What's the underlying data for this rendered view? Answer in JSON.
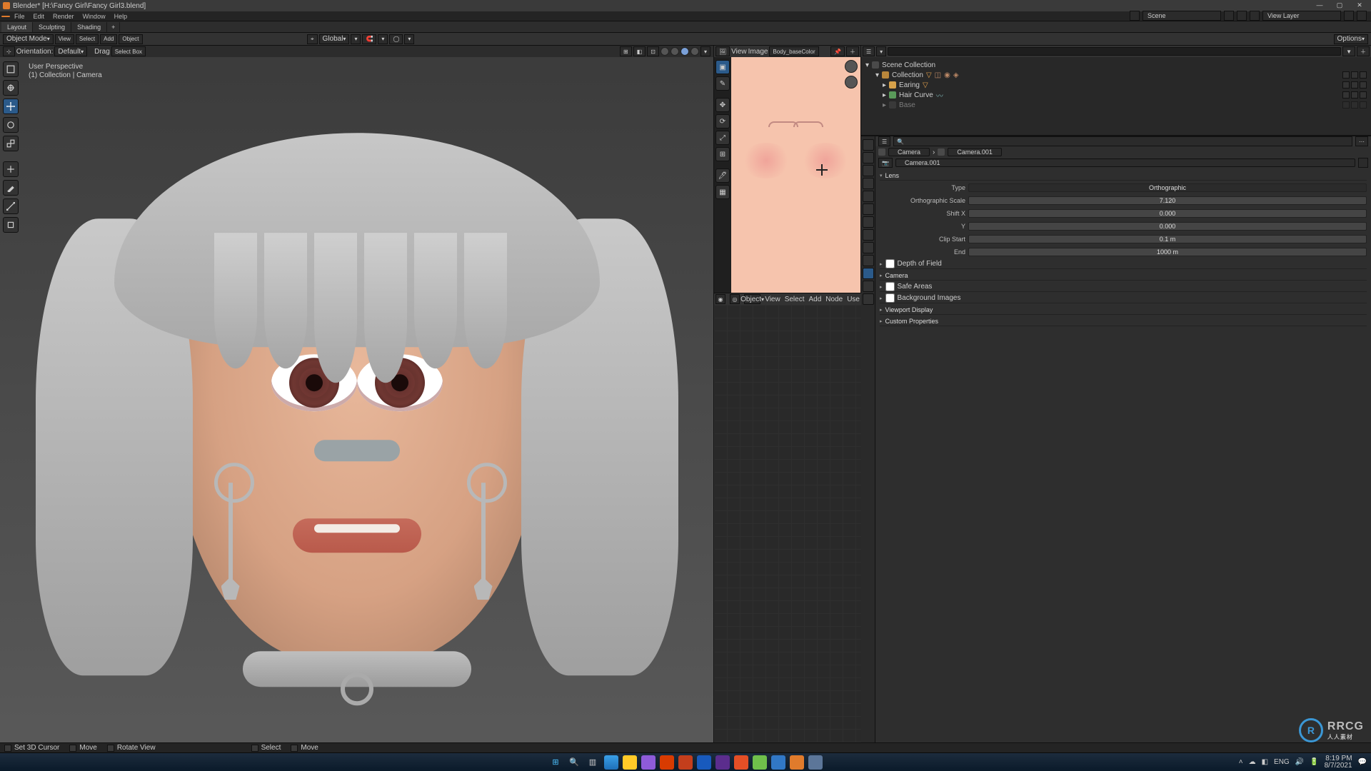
{
  "title": "Blender*  [H:\\Fancy Girl\\Fancy Girl3.blend]",
  "app_menu": [
    "File",
    "Edit",
    "Render",
    "Window",
    "Help"
  ],
  "workspaces": {
    "items": [
      "Layout",
      "Sculpting",
      "Shading"
    ],
    "active": 0,
    "plus": "+"
  },
  "top_scene": {
    "scene_label": "Scene",
    "layer_label": "View Layer"
  },
  "toolbar3d": {
    "mode": "Object Mode",
    "menus": [
      "View",
      "Select",
      "Add",
      "Object"
    ],
    "orientation_label": "Orientation:",
    "global": "Global",
    "drag": "Drag",
    "selectbox": "Select Box",
    "default": "Default",
    "options": "Options"
  },
  "vp_overlay": {
    "line1": "User Perspective",
    "line2": "(1) Collection | Camera"
  },
  "image_panel": {
    "menus": [
      "View",
      "Image"
    ],
    "linked": "Body_baseColor"
  },
  "outliner": {
    "root": "Scene Collection",
    "items": [
      {
        "name": "Collection",
        "depth": 1,
        "icons": 4
      },
      {
        "name": "Earing",
        "depth": 2,
        "icons": 1
      },
      {
        "name": "Hair Curve",
        "depth": 2,
        "icons": 1
      },
      {
        "name": "Base",
        "depth": 2,
        "icons": 0,
        "muted": true
      }
    ]
  },
  "props": {
    "search_placeholder": "",
    "breadcrumb": [
      "Camera",
      "Camera.001"
    ],
    "datablock": "Camera.001",
    "lens_header": "Lens",
    "type_label": "Type",
    "type_value": "Orthographic",
    "ortho_label": "Orthographic Scale",
    "ortho_value": "7.120",
    "shift_label": "Shift X",
    "shift_x": "0.000",
    "shift_y_label": "Y",
    "shift_y": "0.000",
    "clip_start_label": "Clip Start",
    "clip_start": "0.1 m",
    "clip_end_label": "End",
    "clip_end": "1000 m",
    "sections": [
      "Depth of Field",
      "Camera",
      "Safe Areas",
      "Background Images",
      "Viewport Display",
      "Custom Properties"
    ]
  },
  "node_panel": {
    "mode": "Object",
    "menus": [
      "View",
      "Select",
      "Add",
      "Node"
    ],
    "use": "Use"
  },
  "statusbar": {
    "items": [
      {
        "label": "Set 3D Cursor"
      },
      {
        "label": "Move"
      },
      {
        "label": "Rotate View"
      },
      {
        "label": "Select"
      },
      {
        "label": "Move"
      }
    ]
  },
  "taskbar": {
    "lang": "ENG",
    "time": "8:19 PM",
    "date": "8/7/2021"
  },
  "watermark": {
    "brand": "RRCG",
    "sub": "人人素材"
  }
}
